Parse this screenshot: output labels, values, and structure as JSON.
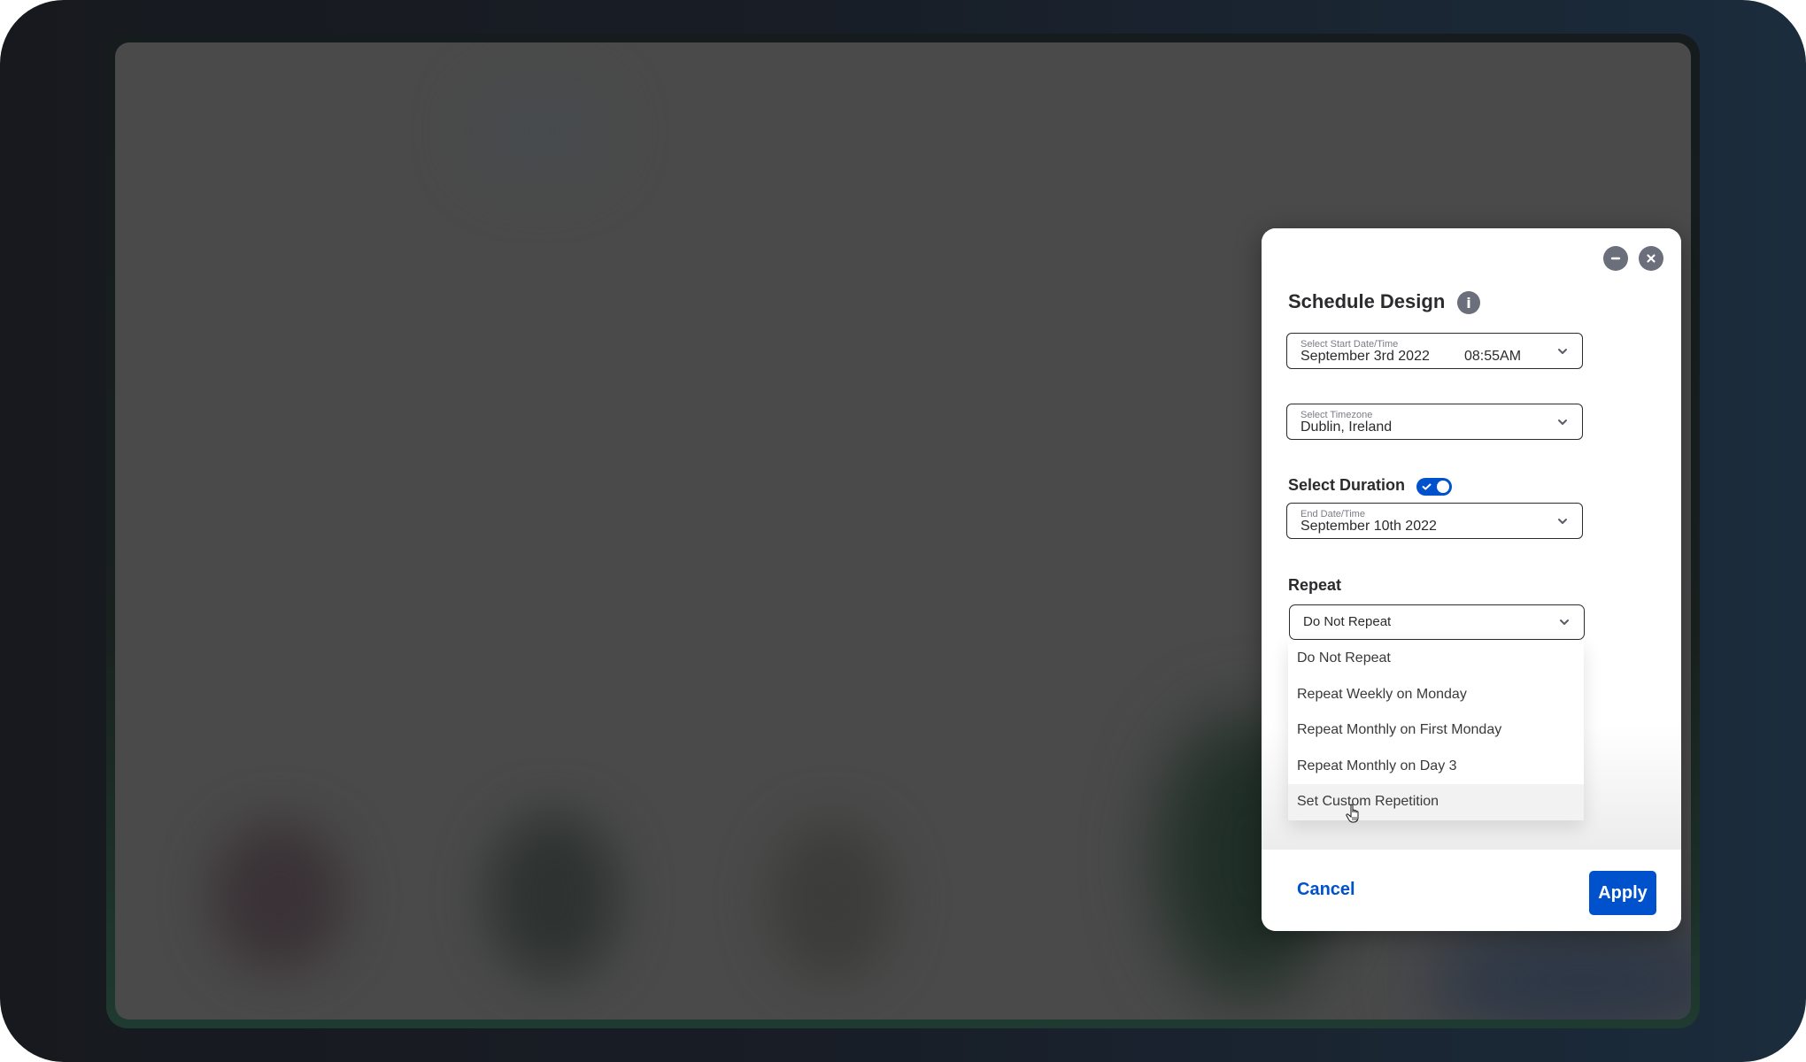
{
  "dialog": {
    "title": "Schedule Design",
    "info_icon": "info-icon",
    "window_controls": {
      "minimize_icon": "minus-circle-icon",
      "close_icon": "close-circle-icon"
    },
    "start": {
      "label": "Select Start Date/Time",
      "date": "September 3rd 2022",
      "time": "08:55AM"
    },
    "timezone": {
      "label": "Select Timezone",
      "value": "Dublin, Ireland"
    },
    "duration": {
      "label": "Select Duration",
      "toggle_on": true,
      "end_label": "End Date/Time",
      "end_value": "September 10th 2022"
    },
    "repeat": {
      "label": "Repeat",
      "selected": "Do Not Repeat",
      "options": [
        "Do Not Repeat",
        "Repeat Weekly on Monday",
        "Repeat Monthly on First Monday",
        "Repeat Monthly on Day 3",
        "Set Custom Repetition"
      ],
      "hovered_index": 4
    },
    "footer": {
      "cancel_label": "Cancel",
      "apply_label": "Apply"
    }
  },
  "colors": {
    "accent": "#0052cc",
    "icon_gray": "#6b6f7c",
    "text": "#2b2b2e",
    "overlay": "#4a4a4a"
  }
}
